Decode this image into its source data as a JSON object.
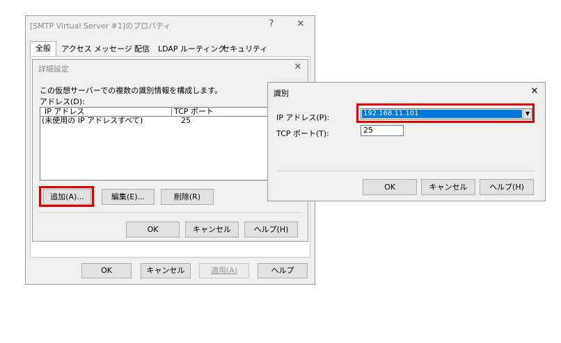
{
  "main_window": {
    "title": "[SMTP Virtual Server #1]のプロパティ",
    "help_glyph": "?",
    "close_glyph": "✕",
    "tabs": [
      {
        "label": "全般"
      },
      {
        "label": "アクセス"
      },
      {
        "label": "メッセージ"
      },
      {
        "label": "配信"
      },
      {
        "label": "LDAP ルーティング"
      },
      {
        "label": "セキュリティ"
      }
    ],
    "buttons": {
      "ok": "OK",
      "cancel": "キャンセル",
      "apply": "適用(A)",
      "help": "ヘルプ"
    }
  },
  "advanced_dialog": {
    "title": "詳細設定",
    "close_glyph": "✕",
    "description": "この仮想サーバーでの複数の識別情報を構成します。",
    "address_label": "アドレス(D):",
    "columns": [
      "IP アドレス",
      "TCP ポート"
    ],
    "rows": [
      {
        "ip": "(未使用の IP アドレスすべて)",
        "port": "25"
      }
    ],
    "buttons": {
      "add": "追加(A)...",
      "edit": "編集(E)...",
      "delete": "削除(R)",
      "ok": "OK",
      "cancel": "キャンセル",
      "help": "ヘルプ(H)"
    }
  },
  "identity_dialog": {
    "title": "識別",
    "close_glyph": "✕",
    "ip_label": "IP アドレス(P):",
    "ip_value": "192.168.11.101",
    "port_label": "TCP ポート(T):",
    "port_value": "25",
    "buttons": {
      "ok": "OK",
      "cancel": "キャンセル",
      "help": "ヘルプ(H)"
    }
  },
  "colors": {
    "highlight": "#e00000",
    "selection": "#0078d7"
  }
}
